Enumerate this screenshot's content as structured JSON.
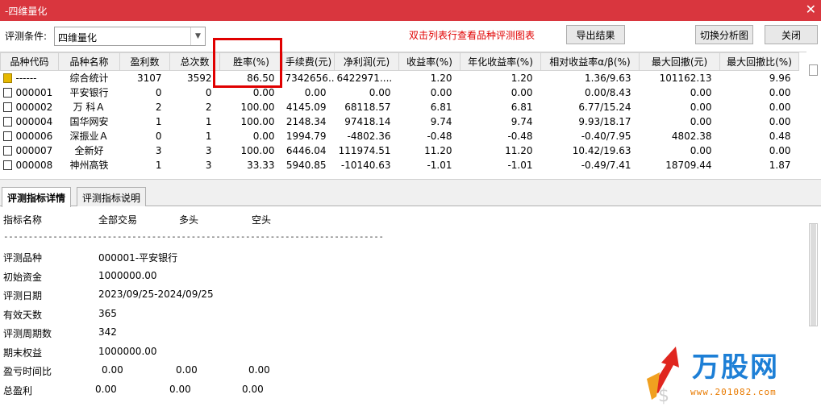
{
  "window": {
    "title": "-四维量化",
    "close_icon": "close-icon"
  },
  "toolbar": {
    "condition_label": "评测条件:",
    "condition_value": "四维量化",
    "hint": "双击列表行查看品种评测图表",
    "export_label": "导出结果",
    "switch_label": "切换分析图",
    "close_label": "关闭"
  },
  "table": {
    "headers": [
      "品种代码",
      "品种名称",
      "盈利数",
      "总次数",
      "胜率(%)",
      "手续费(元)",
      "净利润(元)",
      "收益率(%)",
      "年化收益率(%)",
      "相对收益率α/β(%)",
      "最大回撤(元)",
      "最大回撤比(%)"
    ],
    "rows": [
      [
        "------",
        "综合统计",
        "3107",
        "3592",
        "86.50",
        "7342656....",
        "6422971....",
        "1.20",
        "1.20",
        "1.36/9.63",
        "101162.13",
        "9.96"
      ],
      [
        "000001",
        "平安银行",
        "0",
        "0",
        "0.00",
        "0.00",
        "0.00",
        "0.00",
        "0.00",
        "0.00/8.43",
        "0.00",
        "0.00"
      ],
      [
        "000002",
        "万 科Ａ",
        "2",
        "2",
        "100.00",
        "4145.09",
        "68118.57",
        "6.81",
        "6.81",
        "6.77/15.24",
        "0.00",
        "0.00"
      ],
      [
        "000004",
        "国华网安",
        "1",
        "1",
        "100.00",
        "2148.34",
        "97418.14",
        "9.74",
        "9.74",
        "9.93/18.17",
        "0.00",
        "0.00"
      ],
      [
        "000006",
        "深振业Ａ",
        "0",
        "1",
        "0.00",
        "1994.79",
        "-4802.36",
        "-0.48",
        "-0.48",
        "-0.40/7.95",
        "4802.38",
        "0.48"
      ],
      [
        "000007",
        "全新好",
        "3",
        "3",
        "100.00",
        "6446.04",
        "111974.51",
        "11.20",
        "11.20",
        "10.42/19.63",
        "0.00",
        "0.00"
      ],
      [
        "000008",
        "神州高铁",
        "1",
        "3",
        "33.33",
        "5940.85",
        "-10140.63",
        "-1.01",
        "-1.01",
        "-0.49/7.41",
        "18709.44",
        "1.87"
      ]
    ]
  },
  "tabs": {
    "detail": "评测指标详情",
    "explain": "评测指标说明"
  },
  "detail": {
    "col_name": "指标名称",
    "col_all": "全部交易",
    "col_long": "多头",
    "col_short": "空头",
    "dashes": "-----------------------------------------------------------------------------",
    "items": [
      {
        "label": "评测品种",
        "v1": "000001-平安银行"
      },
      {
        "label": "初始资金",
        "v1": "1000000.00"
      },
      {
        "label": "评测日期",
        "v1": "2023/09/25-2024/09/25"
      },
      {
        "label": "有效天数",
        "v1": "365"
      },
      {
        "label": "评测周期数",
        "v1": "342"
      },
      {
        "label": "期末权益",
        "v1": "1000000.00"
      },
      {
        "label": "盈亏时间比",
        "v1": "0.00",
        "v2": "0.00",
        "v3": "0.00"
      },
      {
        "label": "总盈利",
        "v1": "0.00",
        "v2": "0.00",
        "v3": "0.00"
      }
    ]
  },
  "watermark": {
    "brand": "万股网",
    "url": "www.201082.com"
  },
  "colors": {
    "title_bar": "#d9363e",
    "hint": "#e00000",
    "highlight": "#e00000",
    "brand": "#1d7fd6"
  }
}
